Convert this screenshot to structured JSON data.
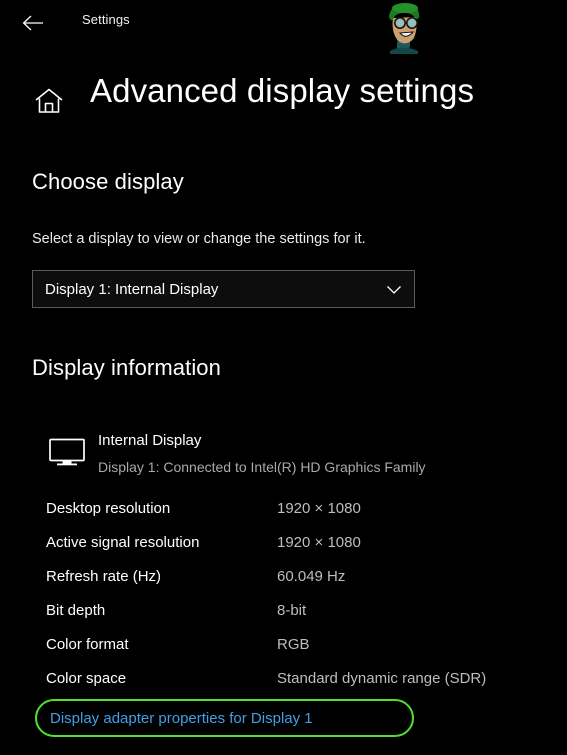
{
  "titlebar": {
    "back_icon": "back-arrow-icon",
    "app_title": "Settings",
    "avatar_alt": "user-avatar"
  },
  "header": {
    "home_icon": "home-icon",
    "page_title": "Advanced display settings"
  },
  "choose_display": {
    "heading": "Choose display",
    "description": "Select a display to view or change the settings for it.",
    "dropdown": {
      "selected": "Display 1: Internal Display",
      "chevron_icon": "chevron-down-icon",
      "options": [
        "Display 1: Internal Display"
      ]
    }
  },
  "display_information": {
    "heading": "Display information",
    "monitor": {
      "icon": "monitor-icon",
      "name": "Internal Display",
      "subtitle": "Display 1: Connected to Intel(R) HD Graphics Family"
    },
    "rows": [
      {
        "label": "Desktop resolution",
        "value": "1920 × 1080"
      },
      {
        "label": "Active signal resolution",
        "value": "1920 × 1080"
      },
      {
        "label": "Refresh rate (Hz)",
        "value": "60.049 Hz"
      },
      {
        "label": "Bit depth",
        "value": "8-bit"
      },
      {
        "label": "Color format",
        "value": "RGB"
      },
      {
        "label": "Color space",
        "value": "Standard dynamic range (SDR)"
      }
    ],
    "adapter_link": "Display adapter properties for Display 1"
  },
  "colors": {
    "background": "#000000",
    "text_primary": "#ffffff",
    "text_secondary": "#bdbdbd",
    "link": "#3fa0e8",
    "highlight_border": "#51e02e",
    "dropdown_border": "#5a5a5a"
  }
}
